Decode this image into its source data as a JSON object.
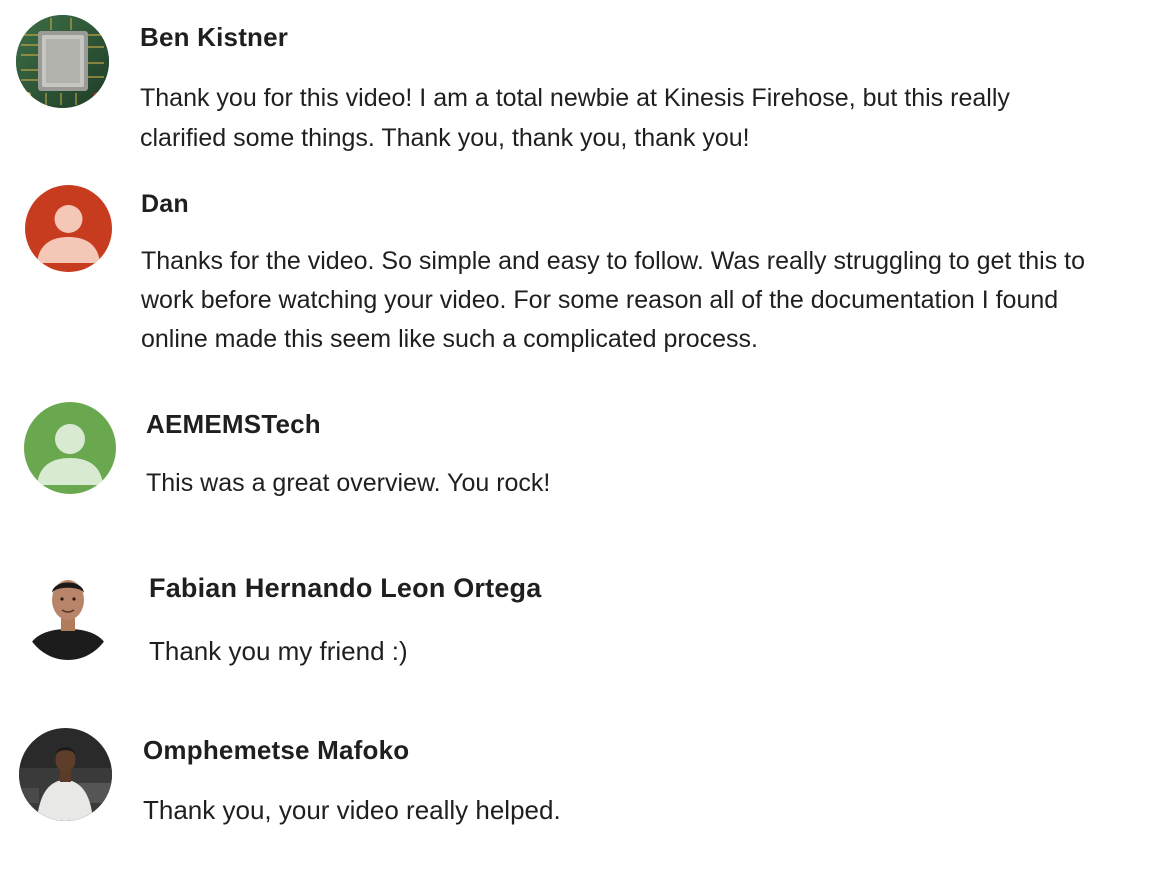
{
  "comments": [
    {
      "author": "Ben Kistner",
      "avatar_icon": "circuit-chip-photo-avatar",
      "text_lines": [
        "Thank you for this video! I am a total newbie at Kinesis Firehose, but this really",
        "clarified some things. Thank you, thank you, thank you!"
      ]
    },
    {
      "author": "Dan",
      "avatar_icon": "default-user-avatar",
      "avatar_color": "#c73b1f",
      "text_lines": [
        "Thanks for the video. So simple and easy to follow. Was really struggling to get this to",
        "work before watching your video. For some reason all of the documentation I found",
        "online made this seem like such a complicated process."
      ]
    },
    {
      "author": "AEMEMSTech",
      "avatar_icon": "default-user-avatar",
      "avatar_color": "#6aa84f",
      "text_lines": [
        "This was a great overview. You rock!"
      ]
    },
    {
      "author": "Fabian Hernando Leon Ortega",
      "avatar_icon": "person-photo-avatar",
      "text_lines": [
        "Thank you my friend :)"
      ]
    },
    {
      "author": "Omphemetse Mafoko",
      "avatar_icon": "person-photo-avatar",
      "text_lines": [
        "Thank you, your video really helped."
      ]
    }
  ]
}
